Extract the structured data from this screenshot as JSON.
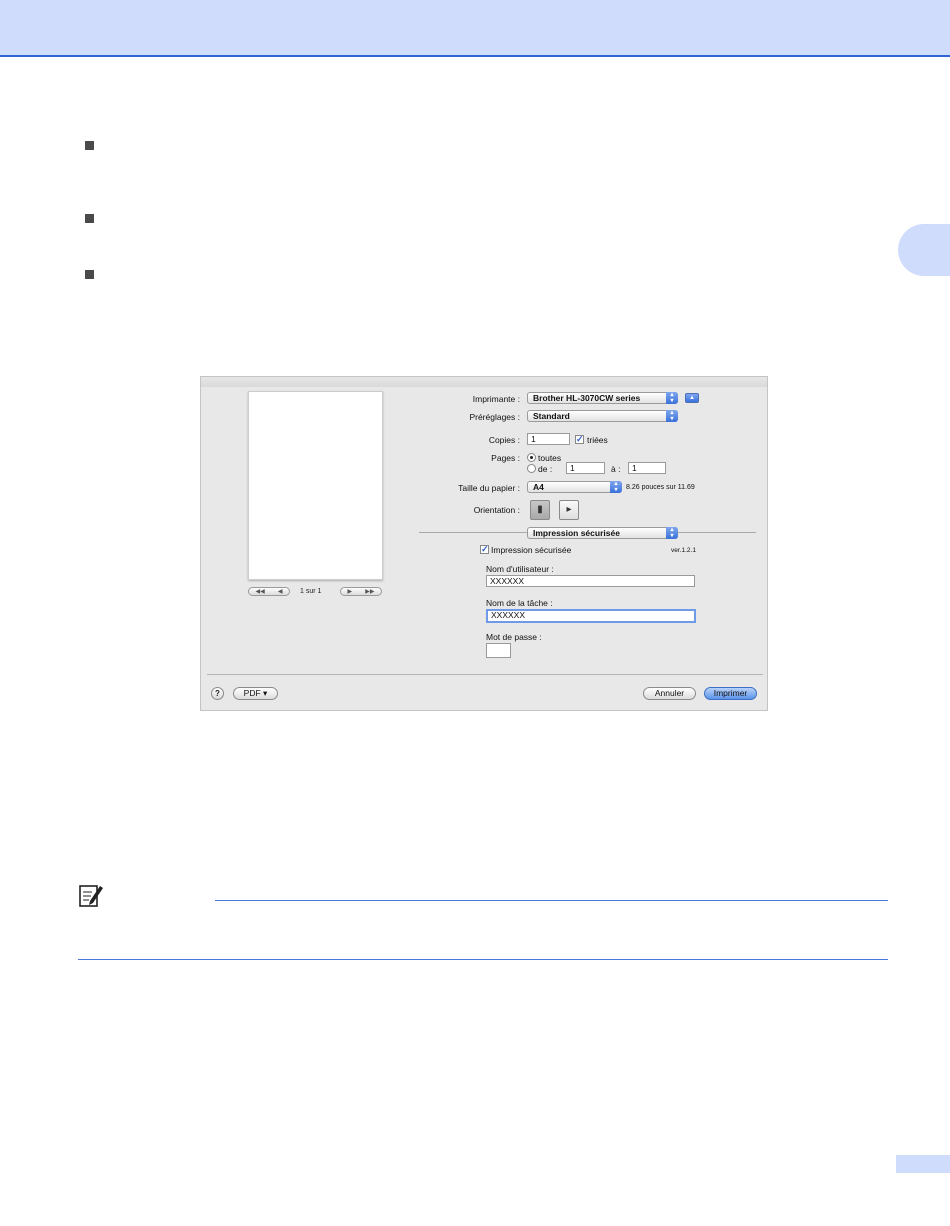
{
  "dialog": {
    "printer_label": "Imprimante :",
    "printer_value": "Brother HL-3070CW series",
    "presets_label": "Préréglages :",
    "presets_value": "Standard",
    "copies_label": "Copies :",
    "copies_value": "1",
    "collated_label": "triées",
    "pages_label": "Pages :",
    "pages_all_label": "toutes",
    "pages_from_label": "de :",
    "pages_from_value": "1",
    "pages_to_label": "à :",
    "pages_to_value": "1",
    "paper_size_label": "Taille du papier :",
    "paper_size_value": "A4",
    "paper_size_desc": "8.26 pouces sur 11.69",
    "orientation_label": "Orientation :",
    "panel_value": "Impression sécurisée",
    "secure_print_label": "Impression sécurisée",
    "version": "ver.1.2.1",
    "user_name_label": "Nom d'utilisateur :",
    "user_name_value": "XXXXXX",
    "job_name_label": "Nom de la tâche :",
    "job_name_value": "XXXXXX",
    "password_label": "Mot de passe :",
    "password_value": "",
    "page_indicator": "1 sur 1",
    "help_label": "?",
    "pdf_label": "PDF ▾",
    "cancel_label": "Annuler",
    "print_label": "Imprimer"
  },
  "colors": {
    "header_band": "#cfdcfb",
    "header_line": "#2f66d6",
    "note_rule": "#4a78d8"
  }
}
